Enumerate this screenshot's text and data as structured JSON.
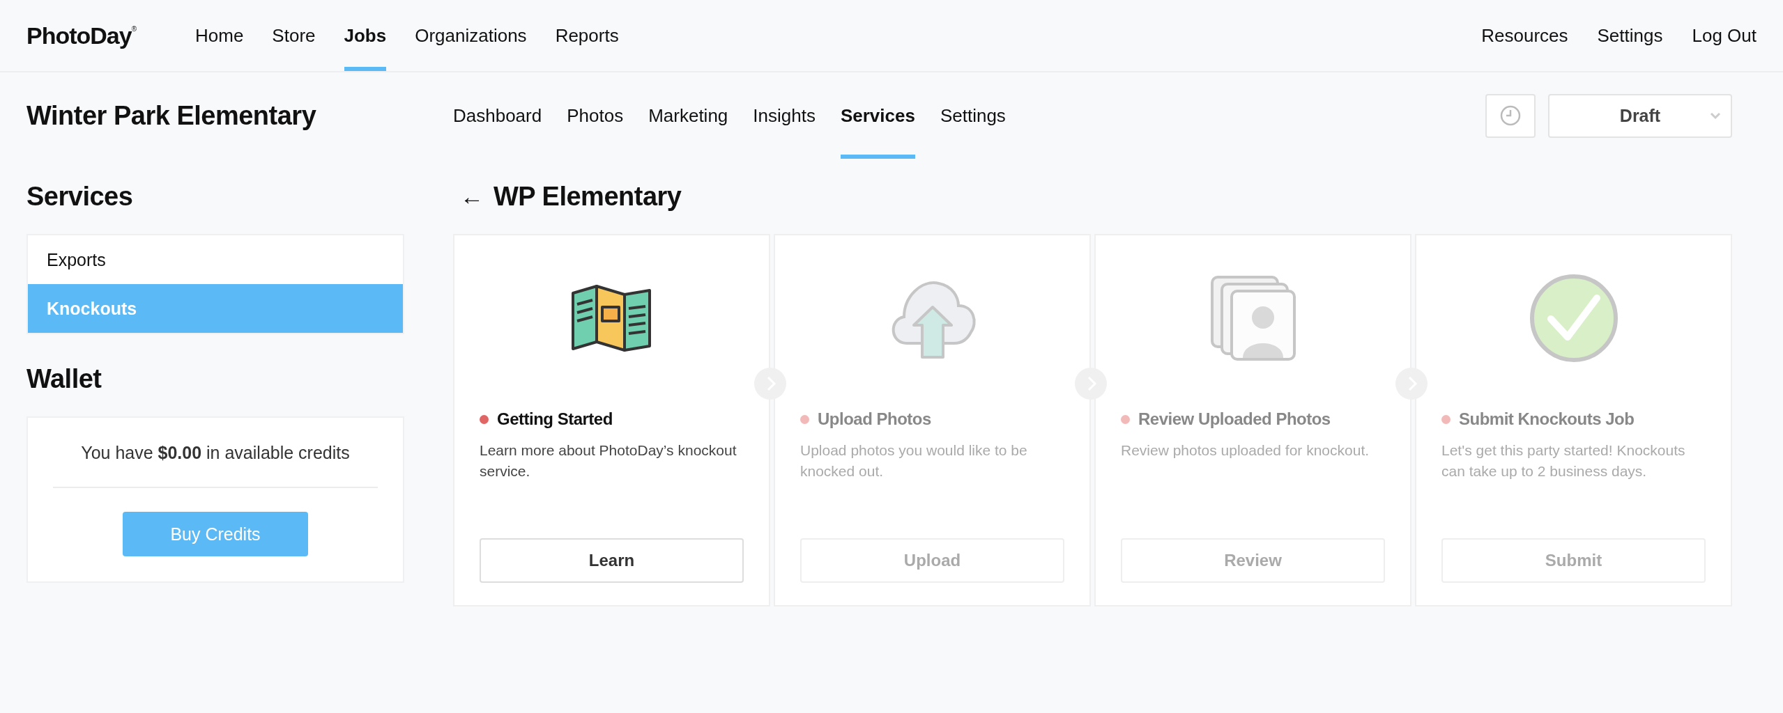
{
  "top_nav": {
    "logo": "PhotoDay",
    "logo_mark": "®",
    "items": [
      {
        "label": "Home",
        "selected": false
      },
      {
        "label": "Store",
        "selected": false
      },
      {
        "label": "Jobs",
        "selected": true
      },
      {
        "label": "Organizations",
        "selected": false
      },
      {
        "label": "Reports",
        "selected": false
      }
    ],
    "right_items": [
      "Resources",
      "Settings",
      "Log Out"
    ]
  },
  "job": {
    "title": "Winter Park Elementary",
    "tabs": [
      {
        "label": "Dashboard",
        "selected": false
      },
      {
        "label": "Photos",
        "selected": false
      },
      {
        "label": "Marketing",
        "selected": false
      },
      {
        "label": "Insights",
        "selected": false
      },
      {
        "label": "Services",
        "selected": true
      },
      {
        "label": "Settings",
        "selected": false
      }
    ],
    "status": "Draft"
  },
  "sidebar": {
    "heading": "Services",
    "items": [
      {
        "label": "Exports",
        "selected": false
      },
      {
        "label": "Knockouts",
        "selected": true
      }
    ],
    "wallet": {
      "heading": "Wallet",
      "text": "You have **$0.00** in available credits",
      "button": "Buy Credits"
    }
  },
  "main": {
    "back_arrow": "←",
    "title": "WP Elementary",
    "steps": [
      {
        "kind": "brochure",
        "title": "Getting Started",
        "description": "Learn more about PhotoDay’s knockout service.",
        "button": "Learn",
        "active": true
      },
      {
        "kind": "upload",
        "title": "Upload Photos",
        "description": "Upload photos you would like to be knocked out.",
        "button": "Upload",
        "active": false
      },
      {
        "kind": "review",
        "title": "Review Uploaded Photos",
        "description": "Review photos uploaded for knockout.",
        "button": "Review",
        "active": false
      },
      {
        "kind": "submit",
        "title": "Submit Knockouts Job",
        "description": "Let's get this party started! Knockouts can take up to 2 business days.",
        "button": "Submit",
        "active": false
      }
    ]
  }
}
